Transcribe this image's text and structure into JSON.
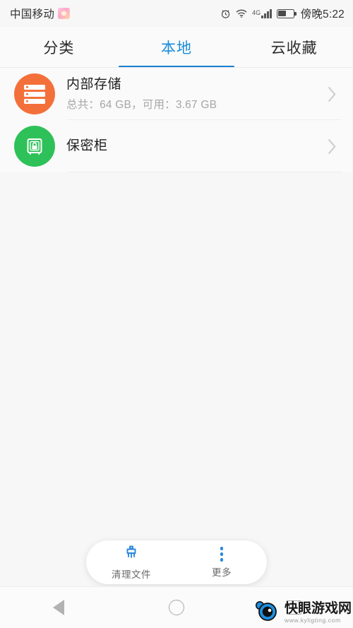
{
  "status_bar": {
    "carrier": "中国移动",
    "carrier_badge_icon": "app-badge-icon",
    "alarm_icon": "alarm-clock-icon",
    "wifi_icon": "wifi-icon",
    "network_label": "4G",
    "signal_icon": "signal-bars-icon",
    "battery_icon": "battery-icon",
    "battery_level_percent": 55,
    "time": "傍晚5:22"
  },
  "tabs": [
    {
      "label": "分类",
      "active": false
    },
    {
      "label": "本地",
      "active": true
    },
    {
      "label": "云收藏",
      "active": false
    }
  ],
  "colors": {
    "accent_blue": "#1a8cd8",
    "underline_blue": "#1a7fd0",
    "storage_orange": "#f4703a",
    "safe_green": "#2fc159",
    "page_bg": "#f7f7f7",
    "card_bg": "#fafafa",
    "divider": "#ededed",
    "chevron": "#cfcfcf"
  },
  "list": [
    {
      "icon": "storage-rack-icon",
      "title": "内部存储",
      "subtitle": "总共：64 GB，可用：3.67 GB",
      "chevron_icon": "chevron-right-icon"
    },
    {
      "icon": "safe-lock-icon",
      "title": "保密柜",
      "subtitle": "",
      "chevron_icon": "chevron-right-icon"
    }
  ],
  "dock": {
    "clean": {
      "icon": "broom-icon",
      "label": "清理文件"
    },
    "more": {
      "icon": "more-vertical-dots-icon",
      "label": "更多"
    }
  },
  "nav_bar": {
    "back_icon": "back-triangle-icon",
    "home_icon": "home-circle-icon",
    "recents_icon": "recents-square-icon"
  },
  "watermark": {
    "logo_icon": "eye-mascot-logo-icon",
    "title": "快眼游戏网",
    "url": "www.kyligting.com"
  }
}
